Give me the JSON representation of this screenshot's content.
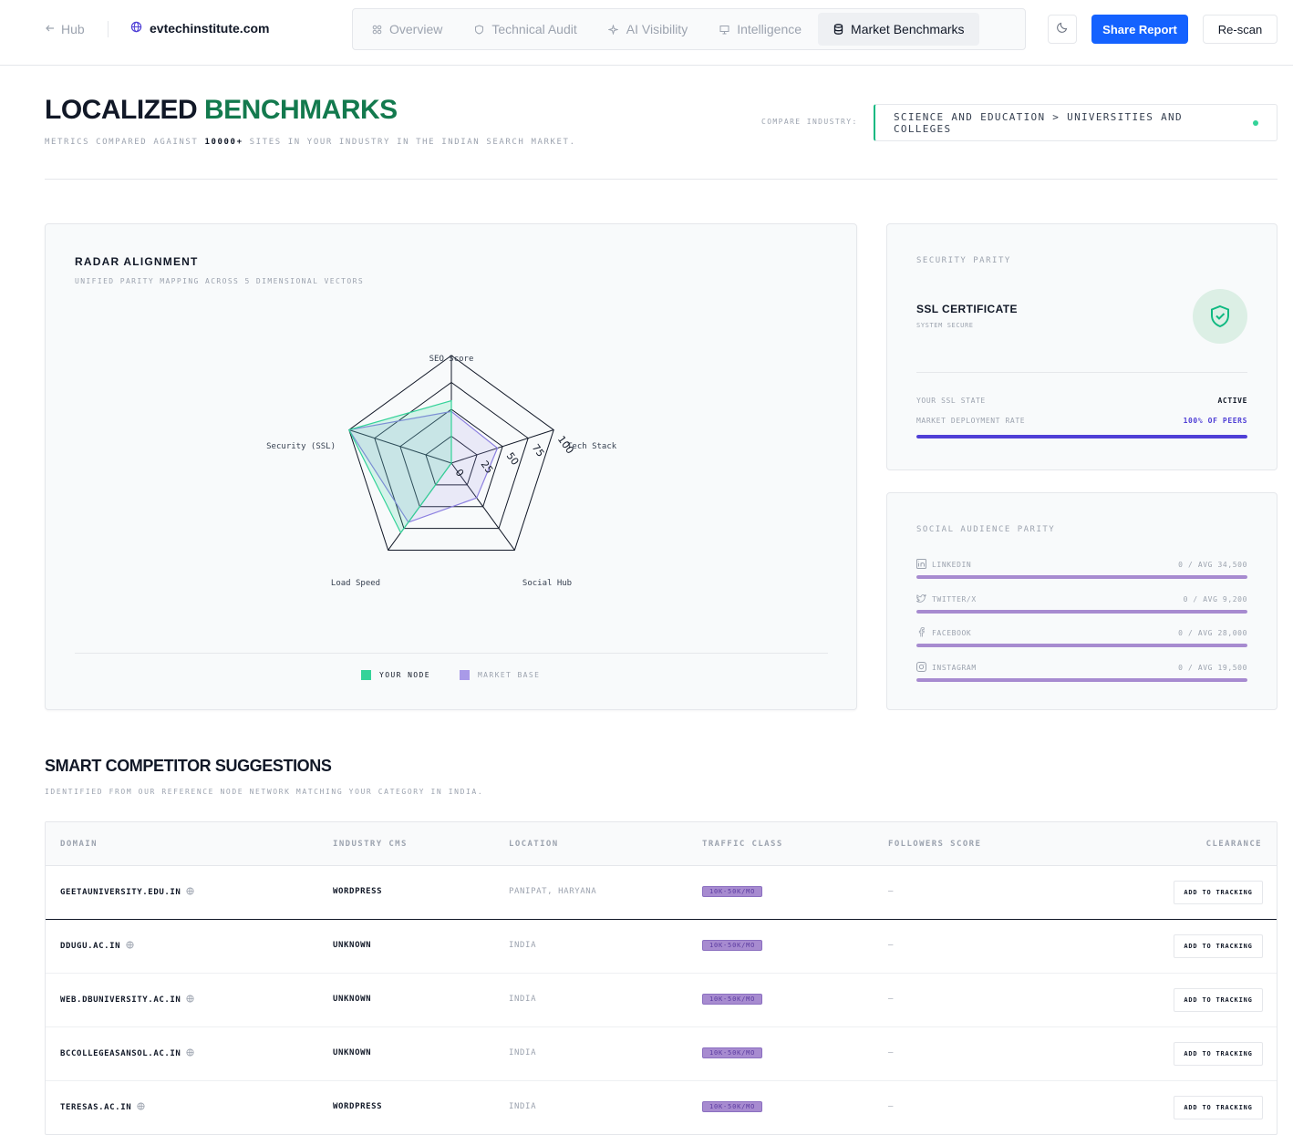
{
  "nav": {
    "hub_label": "Hub",
    "domain": "evtechinstitute.com",
    "tabs": [
      {
        "label": "Overview",
        "icon": "grid-icon"
      },
      {
        "label": "Technical Audit",
        "icon": "shield-icon"
      },
      {
        "label": "AI Visibility",
        "icon": "sparkle-icon"
      },
      {
        "label": "Intelligence",
        "icon": "monitor-icon"
      },
      {
        "label": "Market Benchmarks",
        "icon": "database-icon"
      }
    ],
    "active_tab": "Market Benchmarks",
    "share_label": "Share Report",
    "rescan_label": "Re-scan"
  },
  "header": {
    "title_main": "LOCALIZED",
    "title_accent": "BENCHMARKS",
    "subtitle_pre": "METRICS COMPARED AGAINST",
    "subtitle_count": "10000+",
    "subtitle_post": "SITES IN YOUR INDUSTRY IN THE INDIAN SEARCH MARKET.",
    "compare_label": "COMPARE INDUSTRY:",
    "industry": "SCIENCE AND EDUCATION > UNIVERSITIES AND COLLEGES"
  },
  "radar": {
    "title": "RADAR ALIGNMENT",
    "subtitle": "UNIFIED PARITY MAPPING ACROSS 5 DIMENSIONAL VECTORS",
    "legend_your": "YOUR NODE",
    "legend_market": "MARKET BASE"
  },
  "chart_data": {
    "type": "radar",
    "axes": [
      "SEO Score",
      "Tech Stack",
      "Social Hub",
      "Load Speed",
      "Security (SSL)"
    ],
    "ticks": [
      "0",
      "25",
      "50",
      "75",
      "100"
    ],
    "range": [
      0,
      100
    ],
    "series": [
      {
        "name": "YOUR NODE",
        "values": [
          58,
          0,
          0,
          80,
          100
        ],
        "color": "#34d399"
      },
      {
        "name": "MARKET BASE",
        "values": [
          48,
          45,
          40,
          68,
          100
        ],
        "color": "#8b7fe0"
      }
    ]
  },
  "security": {
    "title": "SECURITY PARITY",
    "item": "SSL CERTIFICATE",
    "item_sub": "SYSTEM SECURE",
    "state_label": "YOUR SSL STATE",
    "state_value": "ACTIVE",
    "rate_label": "MARKET DEPLOYMENT RATE",
    "rate_value": "100% OF PEERS",
    "rate_fraction": 1.0,
    "bar_color": "#4f3fd6"
  },
  "social": {
    "title": "SOCIAL AUDIENCE PARITY",
    "rows": [
      {
        "icon": "linkedin-icon",
        "label": "LINKEDIN",
        "value": "0 / AVG 34,500"
      },
      {
        "icon": "twitter-icon",
        "label": "TWITTER/X",
        "value": "0 / AVG 9,200"
      },
      {
        "icon": "facebook-icon",
        "label": "FACEBOOK",
        "value": "0 / AVG 28,000"
      },
      {
        "icon": "instagram-icon",
        "label": "INSTAGRAM",
        "value": "0 / AVG 19,500"
      }
    ],
    "bar_color": "#a78bd0"
  },
  "competitors": {
    "title": "SMART COMPETITOR SUGGESTIONS",
    "subtitle": "IDENTIFIED FROM OUR REFERENCE NODE NETWORK MATCHING YOUR CATEGORY IN INDIA.",
    "columns": [
      "DOMAIN",
      "INDUSTRY CMS",
      "LOCATION",
      "TRAFFIC CLASS",
      "FOLLOWERS SCORE",
      "CLEARANCE"
    ],
    "rows": [
      {
        "domain": "GEETAUNIVERSITY.EDU.IN",
        "cms": "WORDPRESS",
        "location": "PANIPAT, HARYANA",
        "traffic": "10K-50K/MO",
        "followers": "—",
        "action": "ADD TO TRACKING"
      },
      {
        "domain": "DDUGU.AC.IN",
        "cms": "UNKNOWN",
        "location": "INDIA",
        "traffic": "10K-50K/MO",
        "followers": "—",
        "action": "ADD TO TRACKING"
      },
      {
        "domain": "WEB.DBUNIVERSITY.AC.IN",
        "cms": "UNKNOWN",
        "location": "INDIA",
        "traffic": "10K-50K/MO",
        "followers": "—",
        "action": "ADD TO TRACKING"
      },
      {
        "domain": "BCCOLLEGEASANSOL.AC.IN",
        "cms": "UNKNOWN",
        "location": "INDIA",
        "traffic": "10K-50K/MO",
        "followers": "—",
        "action": "ADD TO TRACKING"
      },
      {
        "domain": "TERESAS.AC.IN",
        "cms": "WORDPRESS",
        "location": "INDIA",
        "traffic": "10K-50K/MO",
        "followers": "—",
        "action": "ADD TO TRACKING"
      }
    ]
  }
}
